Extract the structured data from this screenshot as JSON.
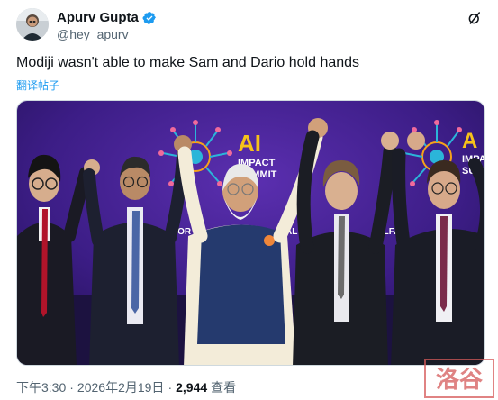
{
  "author": {
    "display_name": "Apurv Gupta",
    "handle": "@hey_apurv",
    "avatar_icon": "avatar-photo",
    "verified_icon": "verified-badge-icon",
    "verified_color": "#1d9bf0"
  },
  "header_action_icon": "grok-slash-icon",
  "tweet": {
    "text": "Modiji wasn't able to make Sam and Dario hold hands",
    "translate_label": "翻译帖子"
  },
  "media": {
    "banner_title": "AI",
    "banner_subtitle_1": "IMPACT",
    "banner_subtitle_2": "SUMMIT",
    "banner_partial_left": "FOR",
    "banner_partial_mid": "AL",
    "banner_partial_right": "ELFA",
    "banner_partial_far": "A",
    "banner_far_1": "IMPACT",
    "banner_far_2": "SUMMI",
    "background_color": "#3c1d86"
  },
  "meta": {
    "time": "下午3:30",
    "separator": "·",
    "date": "2026年2月19日",
    "views_count": "2,944",
    "views_label": "查看"
  },
  "watermark": {
    "text": "洛谷"
  }
}
